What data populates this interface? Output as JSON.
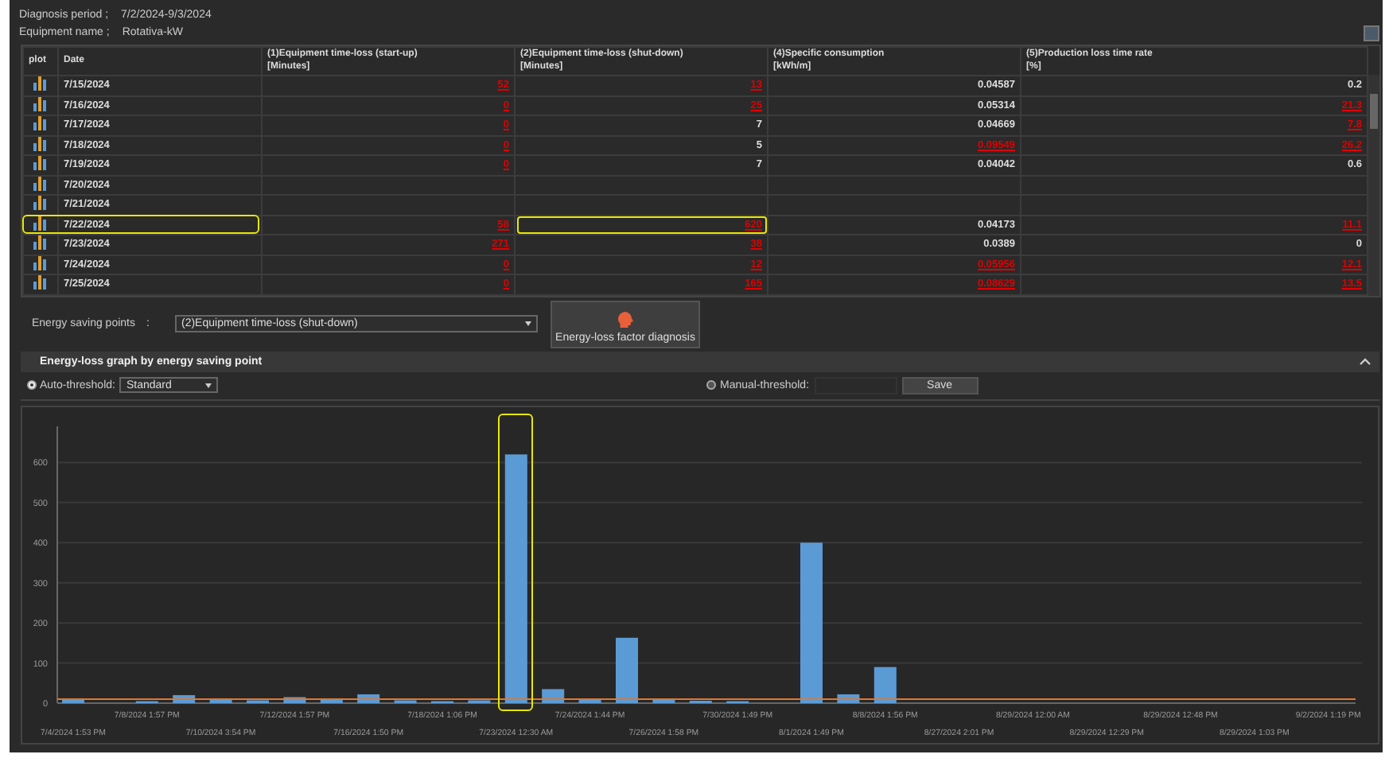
{
  "header": {
    "period_label": "Diagnosis period ;",
    "period": "7/2/2024-9/3/2024",
    "equipment_label": "Equipment name ;",
    "equipment": "Rotativa-kW"
  },
  "table": {
    "columns": [
      "plot",
      "Date",
      "(1)Equipment time-loss (start-up)\n[Minutes]",
      "(2)Equipment time-loss (shut-down)\n[Minutes]",
      "(4)Specific consumption\n[kWh/m]",
      "(5)Production loss time rate\n[%]"
    ],
    "rows": [
      {
        "marked": false,
        "cells": [
          null,
          {
            "text": "7/15/2024",
            "alert": false,
            "marked": false
          },
          {
            "text": "52",
            "alert": true,
            "marked": false
          },
          {
            "text": "13",
            "alert": true,
            "marked": false
          },
          {
            "text": "0.04587",
            "alert": false,
            "marked": false
          },
          {
            "text": "0.2",
            "alert": false,
            "marked": false
          }
        ]
      },
      {
        "marked": false,
        "cells": [
          null,
          {
            "text": "7/16/2024",
            "alert": false,
            "marked": false
          },
          {
            "text": "0",
            "alert": true,
            "marked": false
          },
          {
            "text": "25",
            "alert": true,
            "marked": false
          },
          {
            "text": "0.05314",
            "alert": false,
            "marked": false
          },
          {
            "text": "21.3",
            "alert": true,
            "marked": false
          }
        ]
      },
      {
        "marked": false,
        "cells": [
          null,
          {
            "text": "7/17/2024",
            "alert": false,
            "marked": false
          },
          {
            "text": "0",
            "alert": true,
            "marked": false
          },
          {
            "text": "7",
            "alert": false,
            "marked": false
          },
          {
            "text": "0.04669",
            "alert": false,
            "marked": false
          },
          {
            "text": "7.8",
            "alert": true,
            "marked": false
          }
        ]
      },
      {
        "marked": false,
        "cells": [
          null,
          {
            "text": "7/18/2024",
            "alert": false,
            "marked": false
          },
          {
            "text": "0",
            "alert": true,
            "marked": false
          },
          {
            "text": "5",
            "alert": false,
            "marked": false
          },
          {
            "text": "0.09549",
            "alert": true,
            "marked": false
          },
          {
            "text": "26.2",
            "alert": true,
            "marked": false
          }
        ]
      },
      {
        "marked": false,
        "cells": [
          null,
          {
            "text": "7/19/2024",
            "alert": false,
            "marked": false
          },
          {
            "text": "0",
            "alert": true,
            "marked": false
          },
          {
            "text": "7",
            "alert": false,
            "marked": false
          },
          {
            "text": "0.04042",
            "alert": false,
            "marked": false
          },
          {
            "text": "0.6",
            "alert": false,
            "marked": false
          }
        ]
      },
      {
        "marked": false,
        "cells": [
          null,
          {
            "text": "7/20/2024",
            "alert": false,
            "marked": false
          },
          null,
          null,
          null,
          null
        ]
      },
      {
        "marked": false,
        "cells": [
          null,
          {
            "text": "7/21/2024",
            "alert": false,
            "marked": false
          },
          null,
          null,
          null,
          null
        ]
      },
      {
        "marked": true,
        "cells": [
          null,
          {
            "text": "7/22/2024",
            "alert": false,
            "marked": false
          },
          {
            "text": "58",
            "alert": true,
            "marked": false
          },
          {
            "text": "620",
            "alert": true,
            "marked": true
          },
          {
            "text": "0.04173",
            "alert": false,
            "marked": false
          },
          {
            "text": "11.1",
            "alert": true,
            "marked": false
          }
        ]
      },
      {
        "marked": false,
        "cells": [
          null,
          {
            "text": "7/23/2024",
            "alert": false,
            "marked": false
          },
          {
            "text": "271",
            "alert": true,
            "marked": false
          },
          {
            "text": "38",
            "alert": true,
            "marked": false
          },
          {
            "text": "0.0389",
            "alert": false,
            "marked": false
          },
          {
            "text": "0",
            "alert": false,
            "marked": false
          }
        ]
      },
      {
        "marked": false,
        "cells": [
          null,
          {
            "text": "7/24/2024",
            "alert": false,
            "marked": false
          },
          {
            "text": "0",
            "alert": true,
            "marked": false
          },
          {
            "text": "12",
            "alert": true,
            "marked": false
          },
          {
            "text": "0.05956",
            "alert": true,
            "marked": false
          },
          {
            "text": "12.1",
            "alert": true,
            "marked": false
          }
        ]
      },
      {
        "marked": false,
        "cells": [
          null,
          {
            "text": "7/25/2024",
            "alert": false,
            "marked": false
          },
          {
            "text": "0",
            "alert": true,
            "marked": false
          },
          {
            "text": "165",
            "alert": true,
            "marked": false
          },
          {
            "text": "0.08629",
            "alert": true,
            "marked": false
          },
          {
            "text": "13.5",
            "alert": true,
            "marked": false
          }
        ]
      }
    ]
  },
  "controls": {
    "label": "Energy saving points",
    "separator": ":",
    "dropdown": "(2)Equipment time-loss (shut-down)",
    "button": "Energy-loss factor diagnosis"
  },
  "graph_panel": {
    "title": "Energy-loss graph by energy saving point",
    "expanded": true,
    "auto": {
      "label": "Auto-threshold:",
      "selected": true,
      "dropdown": "Standard"
    },
    "manual": {
      "label": "Manual-threshold:",
      "selected": false
    },
    "save": "Save",
    "chart_data": {
      "type": "bar",
      "categories": [
        "7/4/2024 1:53 PM",
        null,
        "7/8/2024 1:57 PM",
        null,
        "7/10/2024 3:54 PM",
        null,
        "7/12/2024 1:57 PM",
        null,
        "7/16/2024 1:50 PM",
        null,
        "7/18/2024 1:06 PM",
        null,
        "7/23/2024 12:30 AM",
        null,
        "7/24/2024 1:44 PM",
        null,
        "7/26/2024 1:58 PM",
        null,
        "7/30/2024 1:49 PM",
        null,
        "8/1/2024 1:49 PM",
        null,
        "8/8/2024 1:56 PM",
        null,
        "8/27/2024 2:01 PM",
        null,
        "8/29/2024 12:00 AM",
        null,
        "8/29/2024 12:29 PM",
        null,
        "8/29/2024 12:48 PM",
        null,
        "8/29/2024 1:03 PM",
        null,
        "9/2/2024 1:19 PM"
      ],
      "series": [
        {
          "color": "#5b9bd5",
          "values": [
            12,
            null,
            5,
            20,
            12,
            7,
            15,
            12,
            22,
            7,
            5,
            7,
            620,
            35,
            10,
            163,
            8,
            6,
            5,
            null,
            400,
            22,
            90,
            0,
            0,
            0,
            0,
            0,
            0,
            0,
            0,
            0,
            0,
            0,
            0
          ]
        }
      ],
      "grid": true,
      "ylim": [
        0,
        690
      ],
      "yticks": [
        0,
        100,
        200,
        300,
        400,
        500,
        600
      ]
    },
    "threshold_shown": true,
    "peak_highlighted": true
  }
}
